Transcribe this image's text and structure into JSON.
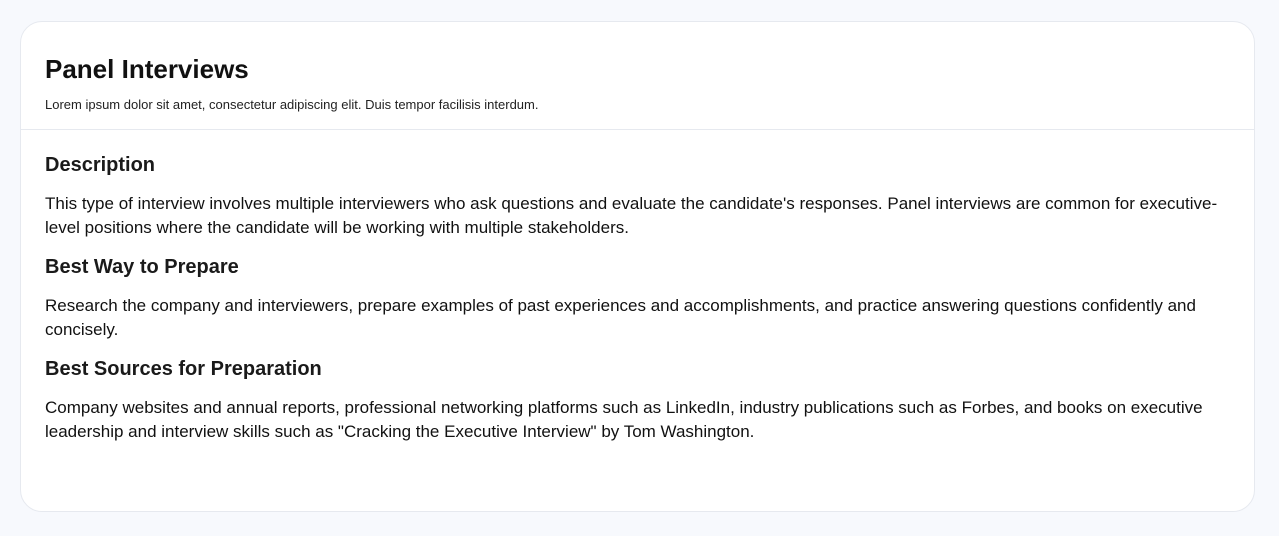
{
  "card": {
    "title": "Panel Interviews",
    "subtitle": "Lorem ipsum dolor sit amet, consectetur adipiscing elit. Duis tempor facilisis interdum."
  },
  "sections": [
    {
      "heading": "Description",
      "text": "This type of interview involves multiple interviewers who ask questions and evaluate the candidate's responses. Panel interviews are common for executive-level positions where the candidate will be working with multiple stakeholders."
    },
    {
      "heading": "Best Way to Prepare",
      "text": "Research the company and interviewers, prepare examples of past experiences and accomplishments, and practice answering questions confidently and concisely."
    },
    {
      "heading": "Best Sources for Preparation",
      "text": "Company websites and annual reports, professional networking platforms such as LinkedIn, industry publications such as Forbes, and books on executive leadership and interview skills such as \"Cracking the Executive Interview\" by Tom Washington."
    }
  ]
}
